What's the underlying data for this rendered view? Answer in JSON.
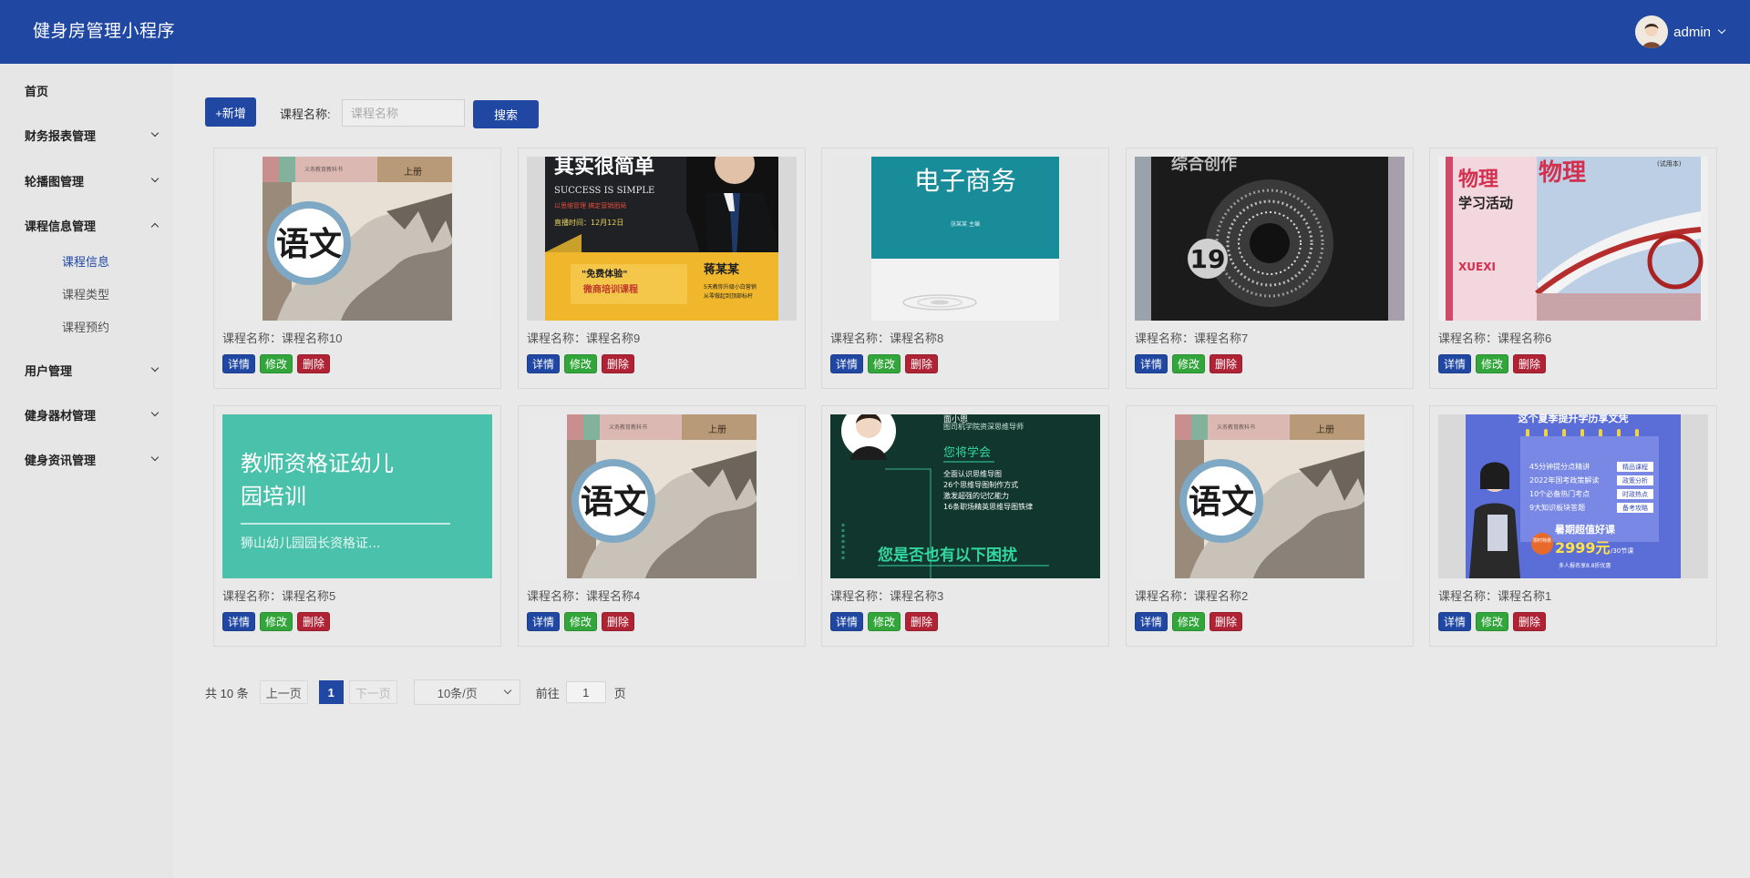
{
  "header": {
    "app_title": "健身房管理小程序",
    "user_name": "admin",
    "avatar_icon": "user-avatar-icon"
  },
  "sidebar": {
    "home": "首页",
    "groups": [
      {
        "label": "财务报表管理"
      },
      {
        "label": "轮播图管理"
      },
      {
        "label": "课程信息管理",
        "expanded": true,
        "children": [
          "课程信息",
          "课程类型",
          "课程预约"
        ],
        "active_child": "课程信息"
      },
      {
        "label": "用户管理"
      },
      {
        "label": "健身器材管理"
      },
      {
        "label": "健身资讯管理"
      }
    ]
  },
  "toolbar": {
    "add_label": "+新增",
    "search_label": "课程名称:",
    "search_placeholder": "课程名称",
    "search_value": "",
    "search_button": "搜索"
  },
  "card_actions": {
    "detail": "详情",
    "edit": "修改",
    "delete": "删除"
  },
  "cards": [
    {
      "name": "课程名称：课程名称10",
      "cover": {
        "kind": "yuwen",
        "publisher": "义务教育教科书",
        "volume": "上册",
        "big": "语文"
      }
    },
    {
      "name": "课程名称：课程名称9",
      "cover": {
        "kind": "success",
        "top": "其实很简单",
        "slogan": "SUCCESS IS SIMPLE",
        "red": "以思维管理 搞定营销困局",
        "date": "直播时间：12月12日",
        "free": "\"免费体验\"",
        "course": "微商培训课程",
        "person": "蒋某某",
        "lines": [
          "5天教你升级小白营销",
          "从零做起到顶部标杆"
        ]
      }
    },
    {
      "name": "课程名称：课程名称8",
      "cover": {
        "kind": "ecommerce",
        "title": "电子商务",
        "sub": "张某某  主编"
      }
    },
    {
      "name": "课程名称：课程名称7",
      "cover": {
        "kind": "dark",
        "top": "综合创作",
        "num": "19"
      }
    },
    {
      "name": "课程名称：课程名称6",
      "cover": {
        "kind": "physics",
        "t1": "物理",
        "t2": "学习活动",
        "t3": "XUEXI",
        "t4": "物理",
        "t5": "(试用本)"
      }
    },
    {
      "name": "课程名称：课程名称5",
      "cover": {
        "kind": "teal",
        "line1": "教师资格证幼儿",
        "line2": "园培训",
        "line3": "狮山幼儿园园长资格证..."
      }
    },
    {
      "name": "课程名称：课程名称4",
      "cover": {
        "kind": "yuwen",
        "publisher": "义务教育教科书",
        "volume": "上册",
        "big": "语文"
      }
    },
    {
      "name": "课程名称：课程名称3",
      "cover": {
        "kind": "mind",
        "name": "面小恩",
        "role": "图司机学院资深思维导师",
        "learn": "您将学会",
        "items": [
          "全面认识思维导图",
          "26个思维导图制作方式",
          "激发超强的记忆能力",
          "16条职场精英思维导图铁律"
        ],
        "question": "您是否也有以下困扰"
      }
    },
    {
      "name": "课程名称：课程名称2",
      "cover": {
        "kind": "yuwen",
        "publisher": "义务教育教科书",
        "volume": "上册",
        "big": "语文"
      }
    },
    {
      "name": "课程名称：课程名称1",
      "cover": {
        "kind": "promo",
        "top": "这个夏季提升学历享文凭",
        "items": [
          [
            "45分钟提分点精讲",
            "精品课程"
          ],
          [
            "2022年国考政策解读",
            "政策分析"
          ],
          [
            "10个必备热门考点",
            "时政热点"
          ],
          [
            "9大知识板块答题",
            "备考攻略"
          ]
        ],
        "tag": "限时特惠",
        "offer": "暑期超值好课",
        "price": "2999元",
        "unit": "/30节课",
        "note": "多人报名享8.8折优惠"
      }
    }
  ],
  "pagination": {
    "total": "共 10 条",
    "prev": "上一页",
    "current": "1",
    "next": "下一页",
    "page_size": "10条/页",
    "goto": "前往",
    "goto_value": "1",
    "page_unit": "页"
  },
  "colors": {
    "primary": "#2048a3",
    "edit": "#32a63a",
    "delete": "#b02335"
  }
}
